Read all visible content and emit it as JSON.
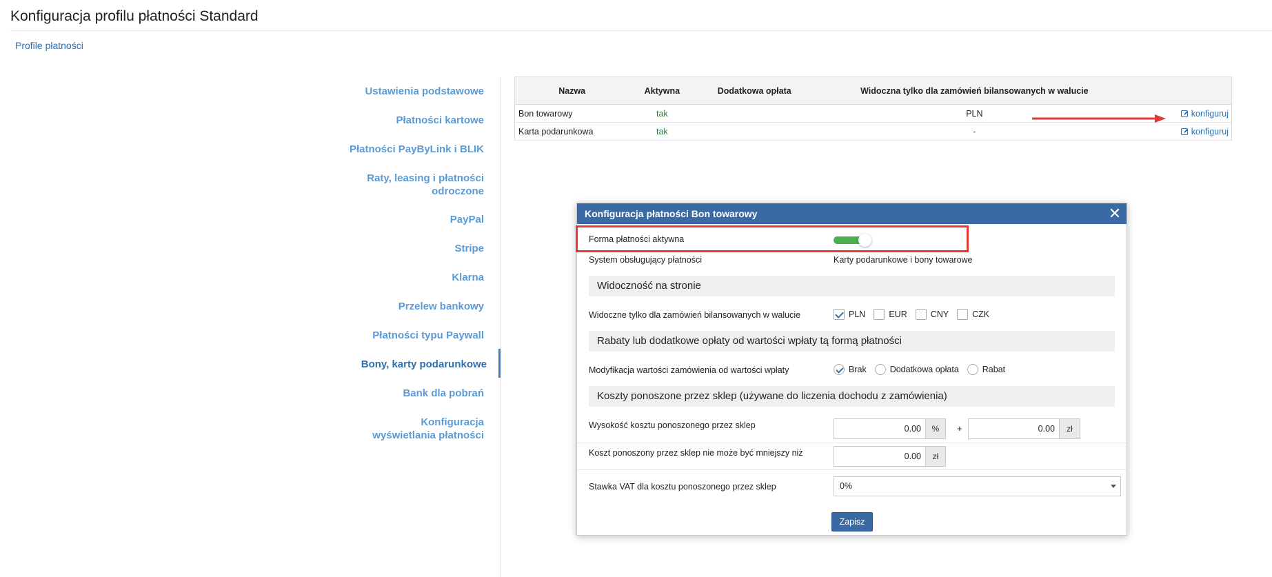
{
  "page": {
    "title": "Konfiguracja profilu płatności Standard",
    "breadcrumb": "Profile płatności"
  },
  "sidebar": {
    "items": [
      {
        "label": "Ustawienia podstawowe"
      },
      {
        "label": "Płatności kartowe"
      },
      {
        "label": "Płatności PayByLink i BLIK"
      },
      {
        "label": "Raty, leasing i płatności odroczone"
      },
      {
        "label": "PayPal"
      },
      {
        "label": "Stripe"
      },
      {
        "label": "Klarna"
      },
      {
        "label": "Przelew bankowy"
      },
      {
        "label": "Płatności typu Paywall"
      },
      {
        "label": "Bony, karty podarunkowe",
        "active": true
      },
      {
        "label": "Bank dla pobrań"
      },
      {
        "label": "Konfiguracja wyświetlania płatności"
      }
    ]
  },
  "table": {
    "headers": [
      "Nazwa",
      "Aktywna",
      "Dodatkowa opłata",
      "Widoczna tylko dla zamówień bilansowanych w walucie",
      ""
    ],
    "rows": [
      {
        "name": "Bon towarowy",
        "active": "tak",
        "fee": "",
        "currency": "PLN",
        "action": "konfiguruj"
      },
      {
        "name": "Karta podarunkowa",
        "active": "tak",
        "fee": "",
        "currency": "-",
        "action": "konfiguruj"
      }
    ]
  },
  "modal": {
    "title": "Konfiguracja płatności Bon towarowy",
    "close_glyph": "✕",
    "active_label": "Forma płatności aktywna",
    "active_on": true,
    "system_label": "System obsługujący płatności",
    "system_value": "Karty podarunkowe i bony towarowe",
    "section_visibility": "Widoczność na stronie",
    "visibility_label": "Widoczne tylko dla zamówień bilansowanych w walucie",
    "currencies": [
      {
        "code": "PLN",
        "checked": true
      },
      {
        "code": "EUR",
        "checked": false
      },
      {
        "code": "CNY",
        "checked": false
      },
      {
        "code": "CZK",
        "checked": false
      }
    ],
    "section_discounts": "Rabaty lub dodatkowe opłaty od wartości wpłaty tą formą płatności",
    "modification_label": "Modyfikacja wartości zamówienia od wartości wpłaty",
    "modification_options": [
      {
        "label": "Brak",
        "checked": true
      },
      {
        "label": "Dodatkowa opłata",
        "checked": false
      },
      {
        "label": "Rabat",
        "checked": false
      }
    ],
    "section_costs": "Koszty ponoszone przez sklep (używane do liczenia dochodu z zamówienia)",
    "cost_label": "Wysokość kosztu ponoszonego przez sklep",
    "cost_percent_value": "0.00",
    "cost_percent_unit": "%",
    "plus_sign": "+",
    "cost_amount_value": "0.00",
    "cost_amount_unit": "zł",
    "min_cost_label": "Koszt ponoszony przez sklep nie może być mniejszy niż",
    "min_cost_value": "0.00",
    "min_cost_unit": "zł",
    "vat_label": "Stawka VAT dla kosztu ponoszonego przez sklep",
    "vat_value": "0%",
    "save_label": "Zapisz"
  },
  "colors": {
    "accent": "#3a6aa6",
    "link": "#2f6fb0",
    "nav_link": "#5b9bd5",
    "active_green": "#2e7d32",
    "toggle_on": "#4caf50",
    "highlight_red": "#e53935"
  }
}
